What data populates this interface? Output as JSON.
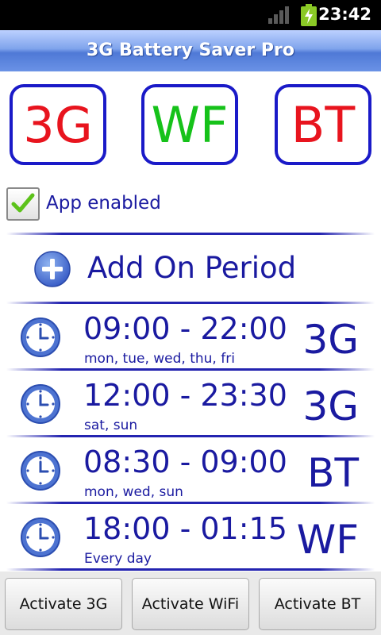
{
  "status_bar": {
    "time": "23:42"
  },
  "app": {
    "title": "3G Battery Saver Pro"
  },
  "network_buttons": [
    {
      "label": "3G",
      "color": "#e8141e"
    },
    {
      "label": "WF",
      "color": "#16c21a"
    },
    {
      "label": "BT",
      "color": "#e8141e"
    }
  ],
  "app_enabled": {
    "label": "App enabled",
    "checked": true
  },
  "add_period": {
    "label": "Add On Period"
  },
  "periods": [
    {
      "time": "09:00 - 22:00",
      "days": "mon, tue, wed, thu, fri",
      "network": "3G"
    },
    {
      "time": "12:00 - 23:30",
      "days": "sat, sun",
      "network": "3G"
    },
    {
      "time": "08:30 - 09:00",
      "days": "mon, wed, sun",
      "network": "BT"
    },
    {
      "time": "18:00 - 01:15",
      "days": "Every day",
      "network": "WF"
    }
  ],
  "actions": [
    {
      "label": "Activate 3G"
    },
    {
      "label": "Activate WiFi"
    },
    {
      "label": "Activate BT"
    }
  ],
  "colors": {
    "accent": "#1a1aa0",
    "border": "#1a1ac8"
  }
}
